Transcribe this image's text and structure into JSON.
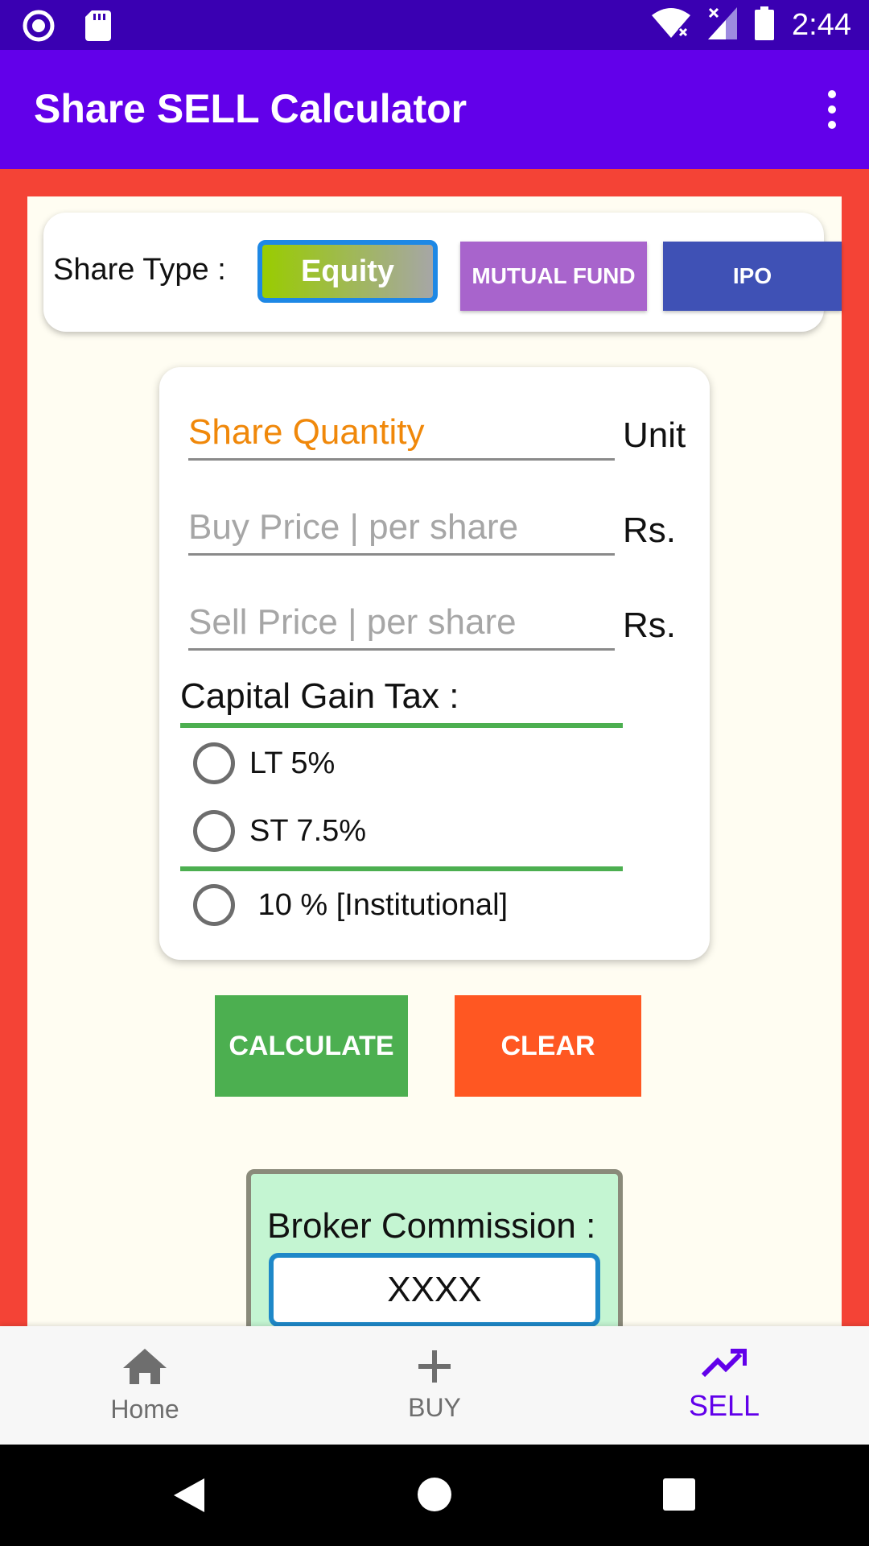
{
  "status_bar": {
    "time": "2:44",
    "icons": [
      "radio-icon",
      "sd-card-icon",
      "wifi-icon",
      "signal-icon",
      "battery-icon"
    ]
  },
  "app_bar": {
    "title": "Share SELL Calculator",
    "menu_icon": "more-vert-icon"
  },
  "share_type": {
    "label": "Share Type :",
    "options": [
      "Equity",
      "MUTUAL FUND",
      "IPO"
    ],
    "selected": "Equity"
  },
  "form": {
    "quantity": {
      "placeholder": "Share Quantity",
      "unit": "Unit"
    },
    "buy_price": {
      "placeholder": "Buy Price | per share",
      "unit": "Rs."
    },
    "sell_price": {
      "placeholder": "Sell Price | per share",
      "unit": "Rs."
    },
    "capital_gain": {
      "title": "Capital Gain Tax :",
      "options": [
        "LT 5%",
        "ST 7.5%",
        " 10 % [Institutional]"
      ]
    }
  },
  "actions": {
    "calculate": "CALCULATE",
    "clear": "CLEAR"
  },
  "broker": {
    "label": "Broker Commission :",
    "value": "XXXX"
  },
  "bottom_nav": {
    "items": [
      {
        "label": "Home",
        "icon": "home-icon",
        "active": false
      },
      {
        "label": "BUY",
        "icon": "plus-icon",
        "active": false
      },
      {
        "label": "SELL",
        "icon": "trending-up-icon",
        "active": true
      }
    ]
  },
  "colors": {
    "status_bar": "#3a00b2",
    "app_bar": "#6200ea",
    "frame": "#f44336",
    "calculate": "#4caf50",
    "clear": "#ff5722",
    "mutual_fund": "#a864cc",
    "ipo": "#3f51b5",
    "accent_active": "#6200ea"
  }
}
